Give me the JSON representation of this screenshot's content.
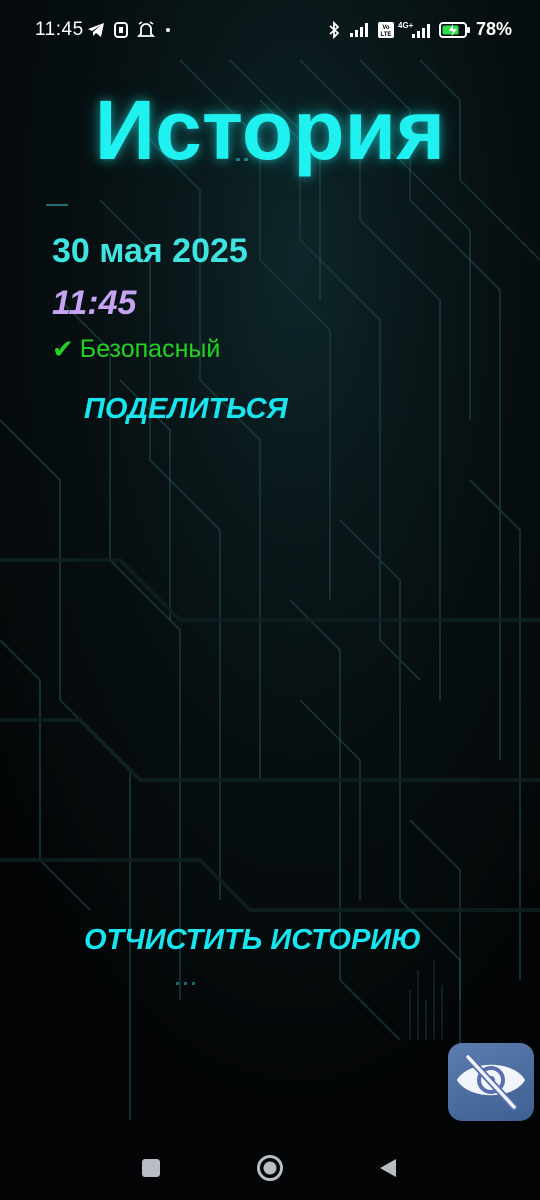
{
  "status_bar": {
    "time": "11:45",
    "battery_percent": "78%",
    "network_label": "4G+",
    "volte_label": "Vo LTE",
    "icons": [
      "telegram-icon",
      "app-icon",
      "alarm-icon",
      "dot-icon",
      "bluetooth-icon",
      "signal-icon",
      "volte-icon",
      "signal-4g-icon",
      "battery-icon"
    ]
  },
  "page": {
    "title": "История"
  },
  "history": {
    "entries": [
      {
        "date": "30 мая 2025",
        "time": "11:45",
        "status_text": "Безопасный",
        "status_icon": "check-icon"
      }
    ]
  },
  "actions": {
    "share_label": "ПОДЕЛИТЬСЯ",
    "clear_label": "ОТЧИСТИТЬ ИСТОРИЮ"
  },
  "floating_button": {
    "icon": "eye-off-icon"
  },
  "nav_bar": {
    "buttons": [
      "recents-button",
      "home-button",
      "back-button"
    ]
  },
  "colors": {
    "title": "#1ff0f0",
    "date": "#3fe3e0",
    "time": "#c7a4f2",
    "status_safe": "#22d422",
    "action": "#17e6ef",
    "background": "#050708"
  }
}
